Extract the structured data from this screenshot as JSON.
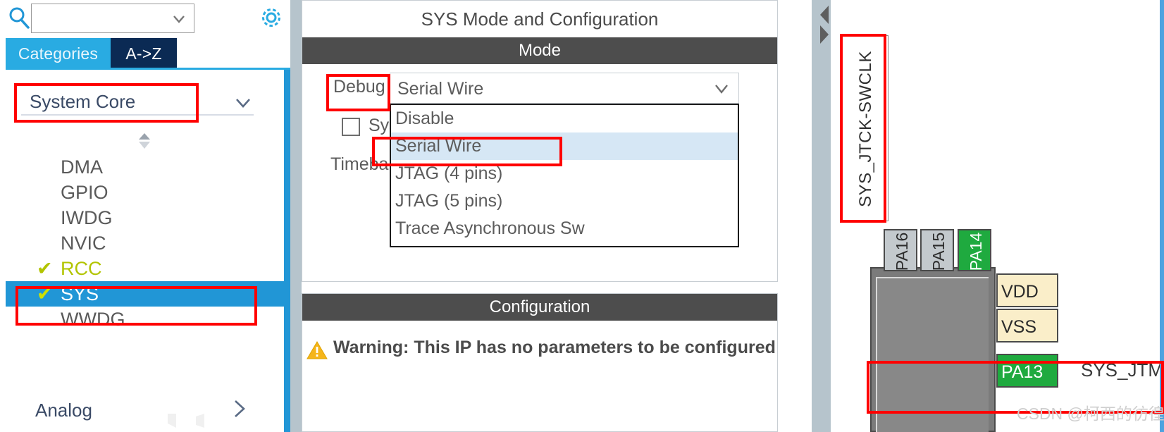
{
  "left_panel": {
    "search": {
      "value": "",
      "placeholder": "",
      "icon": "search-icon",
      "caret_icon": "chevron-down-icon"
    },
    "settings_icon": "gear-icon",
    "tabs": [
      {
        "label": "Categories",
        "selected": true
      },
      {
        "label": "A->Z",
        "selected": false
      }
    ],
    "category": {
      "label": "System Core",
      "chevron_icon": "chevron-down-icon",
      "expanded": true
    },
    "collapse_icon": "collapse-up-down-icon",
    "items": [
      {
        "label": "DMA",
        "checked": false,
        "selected": false
      },
      {
        "label": "GPIO",
        "checked": false,
        "selected": false
      },
      {
        "label": "IWDG",
        "checked": false,
        "selected": false
      },
      {
        "label": "NVIC",
        "checked": false,
        "selected": false
      },
      {
        "label": "RCC",
        "checked": true,
        "selected": false,
        "check_glyph": "✔"
      },
      {
        "label": "SYS",
        "checked": true,
        "selected": true,
        "check_glyph": "✔"
      },
      {
        "label": "WWDG",
        "checked": false,
        "selected": false
      }
    ],
    "next_category": {
      "label": "Analog",
      "chevron_icon": "chevron-right-icon"
    }
  },
  "center_panel": {
    "title": "SYS Mode and Configuration",
    "mode_section": {
      "header": "Mode",
      "debug_label": "Debug",
      "debug_value": "Serial Wire",
      "debug_chevron_icon": "chevron-down-icon",
      "dropdown_open": true,
      "options": [
        {
          "label": "Disable",
          "highlighted": false
        },
        {
          "label": "Serial Wire",
          "highlighted": true
        },
        {
          "label": "JTAG (4 pins)",
          "highlighted": false
        },
        {
          "label": "JTAG (5 pins)",
          "highlighted": false
        },
        {
          "label": "Trace Asynchronous Sw",
          "highlighted": false
        }
      ],
      "system_wake_up_label": "Sys",
      "system_wake_up_checked": false,
      "timebase_label": "Timeba"
    },
    "configuration_section": {
      "header": "Configuration",
      "warning_icon": "warning-triangle-icon",
      "warning_text": "Warning: This IP has no parameters to be configured"
    }
  },
  "splitter": {
    "left_arrow_icon": "triangle-left-icon",
    "right_arrow_icon": "triangle-right-icon"
  },
  "right_panel": {
    "callout_label": "SYS_JTCK-SWCLK",
    "top_pins": [
      {
        "label": "PA16",
        "state": "unused",
        "truncated": true
      },
      {
        "label": "PA15",
        "state": "unused",
        "truncated": false
      },
      {
        "label": "PA14",
        "state": "assigned",
        "truncated": false
      }
    ],
    "right_pins": [
      {
        "label": "VDD",
        "state": "power"
      },
      {
        "label": "VSS",
        "state": "power"
      },
      {
        "label": "PA13",
        "state": "assigned"
      }
    ],
    "pin_signal": "SYS_JTMS-SWDIO",
    "top_right_mark": "··"
  },
  "annotations": {
    "red_boxes": [
      "system-core-highlight",
      "sys-item-highlight",
      "debug-label-highlight",
      "serial-wire-option-highlight",
      "swclk-callout-highlight",
      "pa13-swdio-highlight"
    ],
    "accent_color": "#ff0000"
  },
  "watermark": "CSDN @柯西的彷徨",
  "colors": {
    "tab_active": "#29abe2",
    "tab_az": "#0b2a54",
    "selection_blue": "#2196d6",
    "section_bar": "#4d4d4d",
    "dropdown_highlight": "#d6e7f5",
    "pin_assigned_green": "#1faa3f",
    "pin_power_cream": "#faeec9",
    "warning_amber": "#f5b51a",
    "check_green": "#b2c400"
  }
}
